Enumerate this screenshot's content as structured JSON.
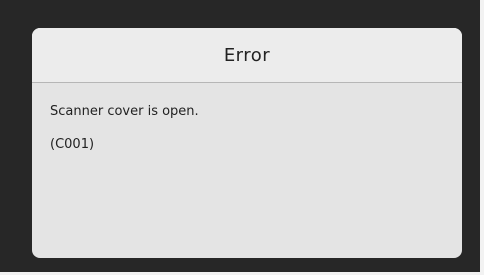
{
  "dialog": {
    "title": "Error",
    "message": "Scanner cover is open.",
    "code": "(C001)"
  },
  "colors": {
    "background": "#272727",
    "dialog": "#e4e4e4",
    "header": "#ececec",
    "text": "#222222",
    "divider": "#b6b6b6"
  }
}
